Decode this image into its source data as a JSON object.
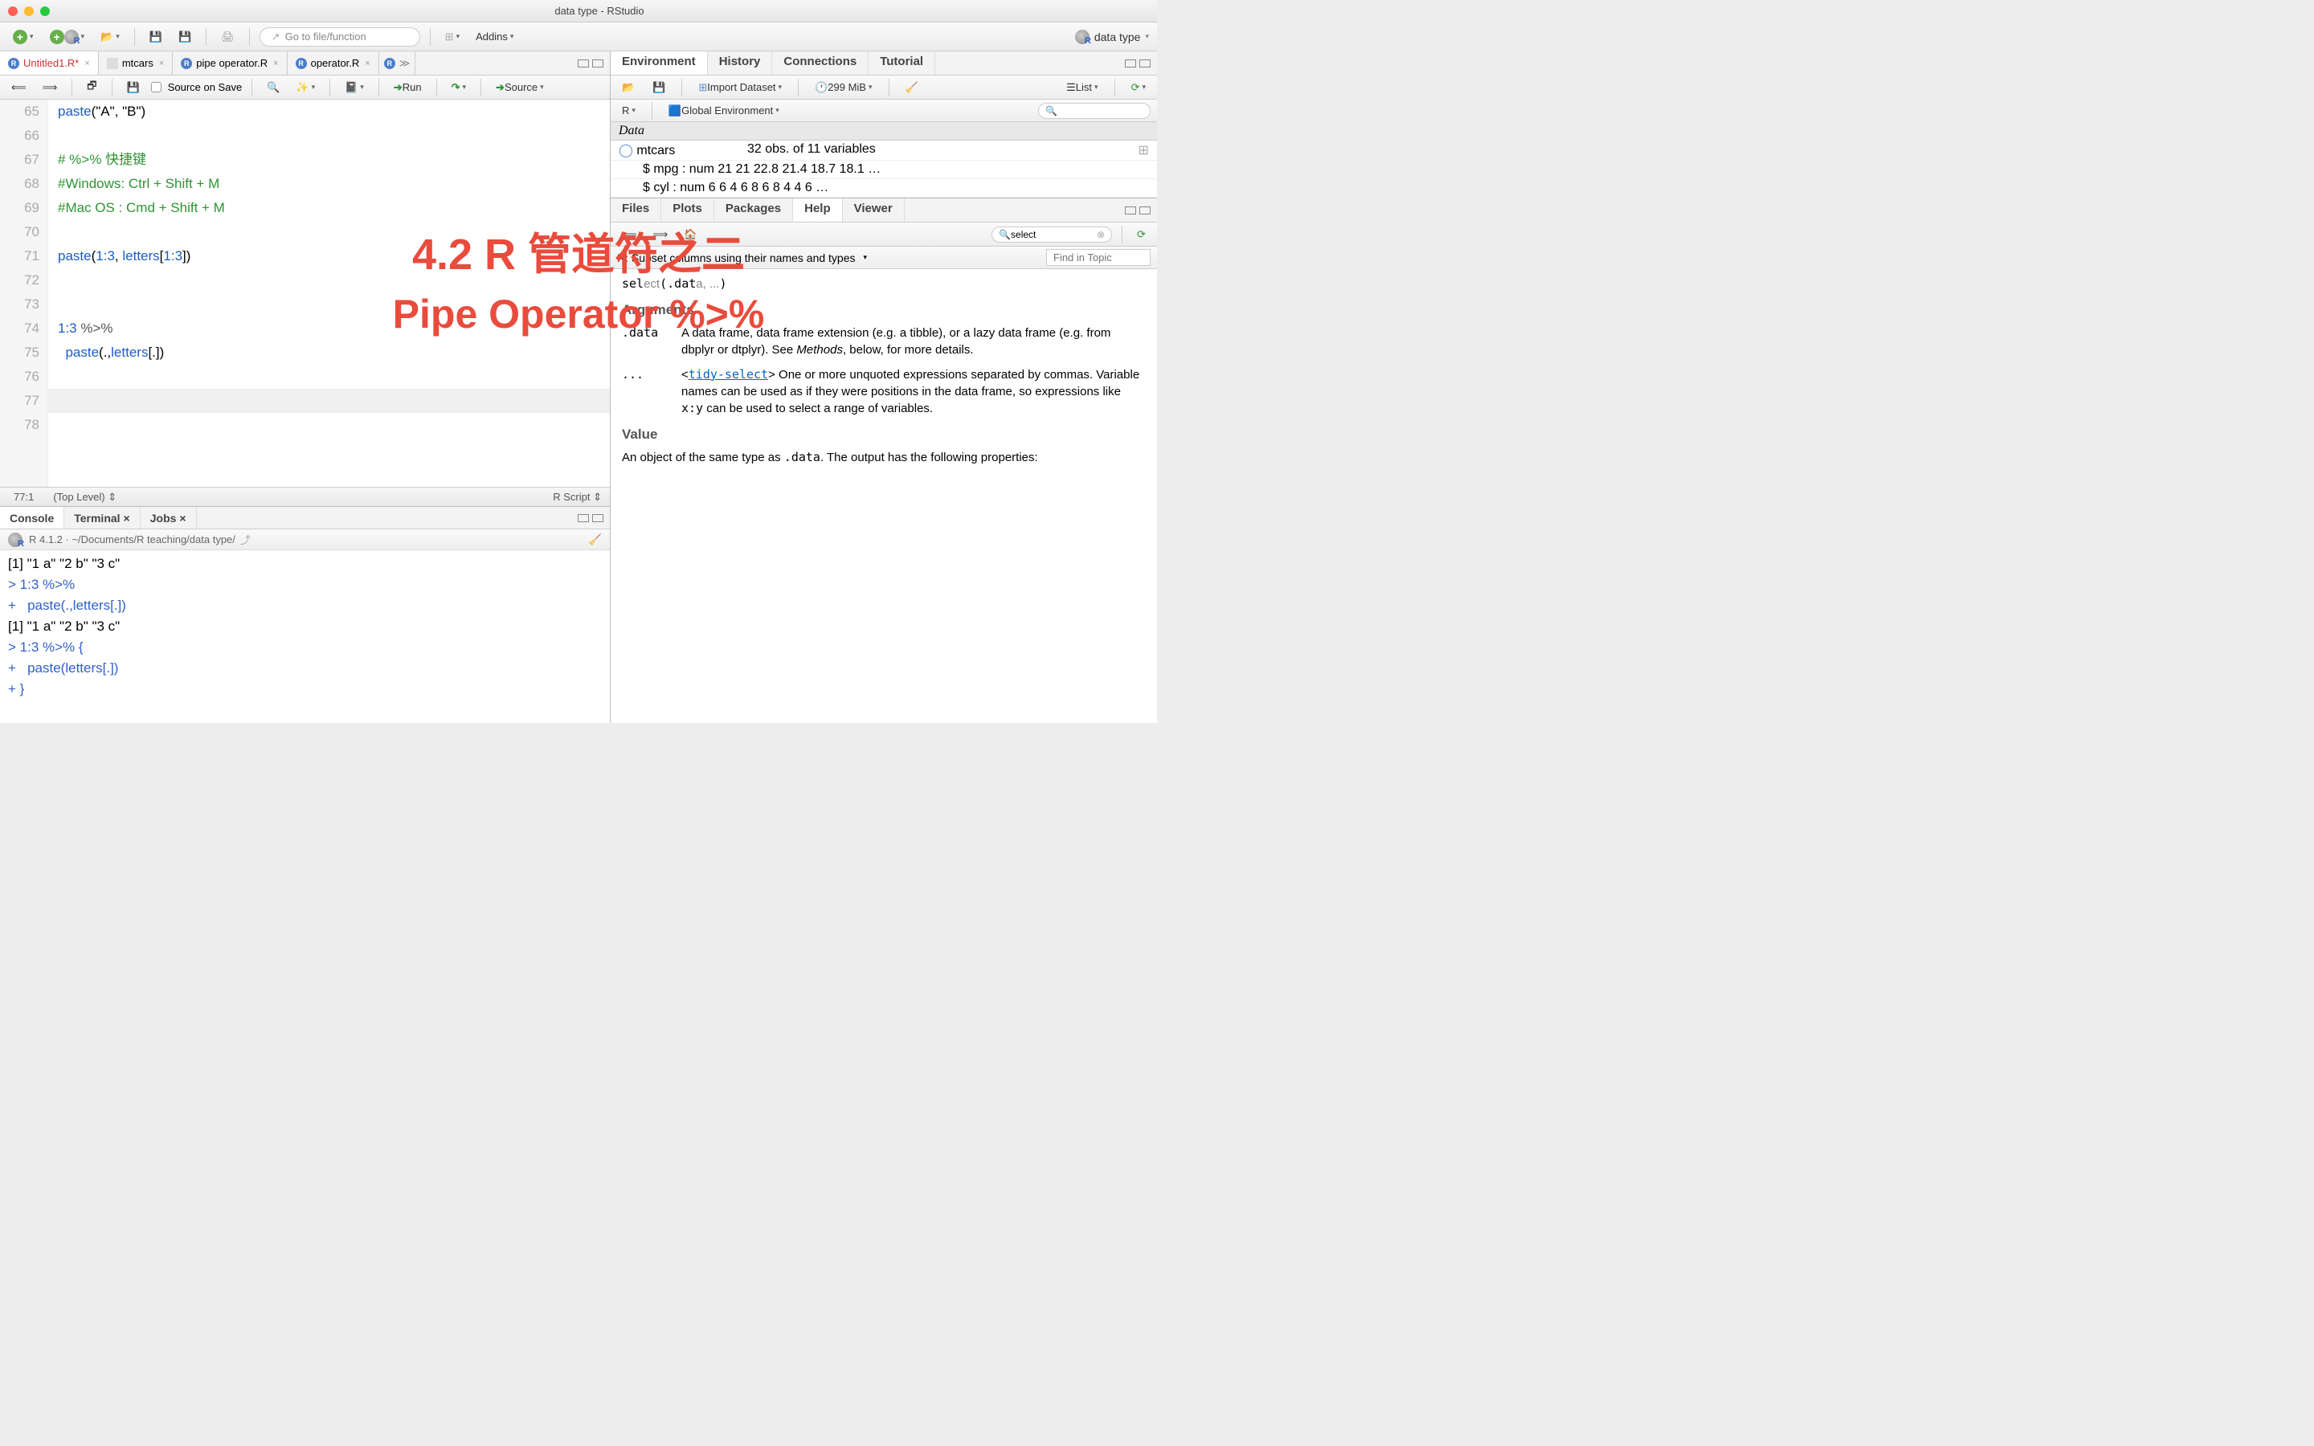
{
  "window": {
    "title": "data type - RStudio"
  },
  "toolbar": {
    "goto_placeholder": "Go to file/function",
    "addins_label": "Addins",
    "project_label": "data type"
  },
  "editor": {
    "tabs": [
      {
        "label": "Untitled1.R*",
        "type": "r",
        "unsaved": true
      },
      {
        "label": "mtcars",
        "type": "data"
      },
      {
        "label": "pipe operator.R",
        "type": "r"
      },
      {
        "label": "operator.R",
        "type": "r"
      }
    ],
    "actions": {
      "source_on_save": "Source on Save",
      "run": "Run",
      "source": "Source"
    },
    "lines": [
      {
        "n": 65,
        "code": "paste(\"A\", \"B\")"
      },
      {
        "n": 66,
        "code": ""
      },
      {
        "n": 67,
        "comment": "# %>% 快捷键"
      },
      {
        "n": 68,
        "comment": "#Windows: Ctrl + Shift + M"
      },
      {
        "n": 69,
        "comment": "#Mac OS : Cmd + Shift + M"
      },
      {
        "n": 70,
        "code": ""
      },
      {
        "n": 71,
        "code": "paste(1:3, letters[1:3])"
      },
      {
        "n": 72,
        "code": ""
      },
      {
        "n": 73,
        "code": ""
      },
      {
        "n": 74,
        "code": "1:3 %>%"
      },
      {
        "n": 75,
        "code": "  paste(.,letters[.])"
      },
      {
        "n": 76,
        "code": ""
      },
      {
        "n": 77,
        "code": "",
        "cursor": true
      },
      {
        "n": 78,
        "code": ""
      }
    ],
    "status": {
      "pos": "77:1",
      "scope": "(Top Level)",
      "type": "R Script"
    }
  },
  "console": {
    "tabs": [
      "Console",
      "Terminal",
      "Jobs"
    ],
    "header": "R 4.1.2 · ~/Documents/R teaching/data type/",
    "out": [
      {
        "t": "out",
        "s": "[1] \"1 a\" \"2 b\" \"3 c\""
      },
      {
        "t": "in",
        "s": "1:3 %>%",
        "p": ">"
      },
      {
        "t": "in",
        "s": "  paste(.,letters[.])",
        "p": "+"
      },
      {
        "t": "out",
        "s": "[1] \"1 a\" \"2 b\" \"3 c\""
      },
      {
        "t": "in",
        "s": "1:3 %>% {",
        "p": ">"
      },
      {
        "t": "in",
        "s": "  paste(letters[.])",
        "p": "+"
      },
      {
        "t": "in",
        "s": "}",
        "p": "+"
      }
    ]
  },
  "env": {
    "tabs": [
      "Environment",
      "History",
      "Connections",
      "Tutorial"
    ],
    "import": "Import Dataset",
    "mem": "299 MiB",
    "view": "List",
    "scope_lang": "R",
    "scope": "Global Environment",
    "section": "Data",
    "items": [
      {
        "name": "mtcars",
        "val": "32 obs. of 11 variables"
      }
    ],
    "expand": [
      "$ mpg : num  21 21 22.8 21.4 18.7 18.1 …",
      "$ cyl : num  6 6 4 6 8 6 8 4 4 6 …"
    ]
  },
  "help": {
    "tabs": [
      "Files",
      "Plots",
      "Packages",
      "Help",
      "Viewer"
    ],
    "search": "select",
    "topic": "R: Subset columns using their names and types",
    "find_placeholder": "Find in Topic",
    "usage_fn": "select(.data, ...)",
    "arguments_title": "Arguments",
    "args": [
      {
        "n": ".data",
        "d_pre": "A data frame, data frame extension (e.g. a tibble), or a lazy data frame (e.g. from dbplyr or dtplyr). See ",
        "d_em": "Methods",
        "d_suf": ", below, for more details."
      },
      {
        "n": "...",
        "d_pre": "<",
        "d_link": "tidy-select",
        "d_mid": "> One or more unquoted expressions separated by commas. Variable names can be used as if they were positions in the data frame, so expressions like ",
        "d_code": "x:y",
        "d_suf": " can be used to select a range of variables."
      }
    ],
    "value_title": "Value",
    "value_text_a": "An object of the same type as ",
    "value_code": ".data",
    "value_text_b": ". The output has the following properties:"
  },
  "overlay": {
    "line1": "4.2 R 管道符之二",
    "line2": "Pipe Operator %>%"
  }
}
